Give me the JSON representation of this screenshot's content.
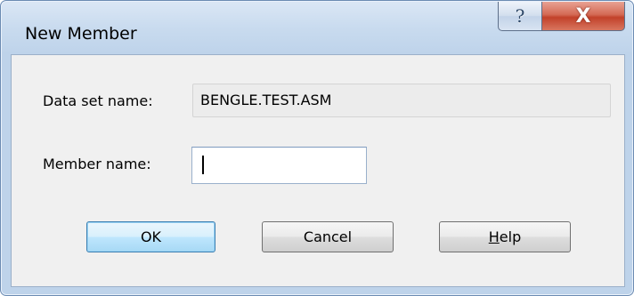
{
  "window": {
    "title": "New Member",
    "help_glyph": "?",
    "close_glyph": "X"
  },
  "form": {
    "dataset_label": "Data set name:",
    "dataset_value": "BENGLE.TEST.ASM",
    "member_label": "Member name:",
    "member_value": "",
    "member_placeholder": ""
  },
  "buttons": {
    "ok": "OK",
    "cancel": "Cancel",
    "help_mnemonic": "H",
    "help_rest": "elp"
  },
  "icons": {
    "help": "question-mark-icon",
    "close": "close-x-icon"
  }
}
